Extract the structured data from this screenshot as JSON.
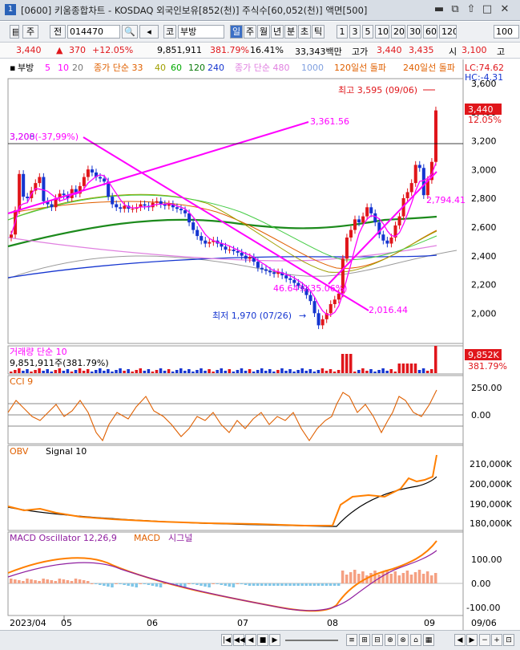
{
  "window": {
    "number": "1",
    "title": "[0600] 키움종합차트 - KOSDAQ 외국인보유[852(천)] 주식수[60,052(천)] 액면[500]"
  },
  "toolbar": {
    "stock_code": "014470",
    "stock_name": "부방",
    "type_label": "주",
    "opt_label": "전",
    "market": "코",
    "periods": [
      "일",
      "주",
      "월",
      "년",
      "분",
      "초",
      "틱"
    ],
    "selected_period": "일",
    "numbers": [
      "1",
      "3",
      "5",
      "10",
      "20",
      "30",
      "60",
      "120"
    ],
    "count": "100"
  },
  "quote": {
    "price": "3,440",
    "change": "370",
    "change_pct": "+12.05%",
    "volume": "9,851,911",
    "vol_ratio": "381.79%",
    "turnover": "16.41%",
    "amount": "33,343백만",
    "high_label": "고가",
    "high_val": "3,440",
    "low_val": "3,435",
    "open_label": "시",
    "open_val": "3,100",
    "close_label": "고"
  },
  "legend": {
    "name": "부방",
    "ma": [
      "5",
      "10",
      "20"
    ],
    "ma_colors": [
      "#ff00ff",
      "#ff00ff",
      "#ff00ff"
    ],
    "l2": "종가 단순 33",
    "l3": [
      "40",
      "60",
      "120",
      "240"
    ],
    "l4": "종가 단순 480",
    "l5": "1000",
    "l6": "120일선 돌파",
    "l7": "240일선 돌파",
    "lc": "LC:74.62",
    "hc": "HC:-4.31"
  },
  "price_panel": {
    "yticks": [
      "3,600",
      "3,400",
      "3,200",
      "3,000",
      "2,800",
      "2,600",
      "2,400",
      "2,200",
      "2,000"
    ],
    "ymin": 1900,
    "ymax": 3650,
    "current": "3,440",
    "current_pct": "12.05%",
    "high_note": "최고 3,595 (09/06)",
    "low_note": "최저 1,970 (07/26)",
    "fib_note1": "3,208",
    "fib_note2": "3,200(-37,99%)",
    "trend_label1": "3,361.56",
    "trend_label2": "2,016.44",
    "trend_label3": "2,794.41",
    "pct_label": "46.64%(35.06%)"
  },
  "volume_panel": {
    "title": "거래량 단순 10",
    "info": "9,851,911주(381.79%)",
    "current": "9,852K",
    "current_pct": "381.79%"
  },
  "cci_panel": {
    "title": "CCI 9",
    "yticks": [
      "250.00",
      "0.00"
    ]
  },
  "obv_panel": {
    "title": "OBV",
    "signal": "Signal 10",
    "yticks": [
      "210,000K",
      "200,000K",
      "190,000K",
      "180,000K"
    ]
  },
  "macd_panel": {
    "title": "MACD Oscillator 12,26,9",
    "l2": "MACD",
    "l3": "시그널",
    "yticks": [
      "100.00",
      "0.00",
      "-100.00"
    ]
  },
  "xaxis": {
    "labels": [
      "2023/04",
      "05",
      "06",
      "07",
      "08",
      "09",
      "09/06"
    ]
  },
  "colors": {
    "up": "#e0161b",
    "down": "#1535d0",
    "trend": "#ff00ff",
    "ma120": "#1c8a1c",
    "macd": "#ff7f00"
  },
  "chart_data": {
    "type": "candlestick",
    "close": [
      2620,
      2780,
      3020,
      2870,
      2860,
      2910,
      2960,
      3000,
      2840,
      2820,
      2800,
      2860,
      2890,
      2880,
      2860,
      2920,
      2890,
      2940,
      3000,
      3050,
      3030,
      3000,
      2990,
      2970,
      2870,
      2820,
      2800,
      2790,
      2810,
      2790,
      2790,
      2800,
      2820,
      2810,
      2800,
      2830,
      2840,
      2820,
      2810,
      2820,
      2800,
      2790,
      2780,
      2760,
      2700,
      2650,
      2610,
      2580,
      2560,
      2570,
      2580,
      2560,
      2540,
      2520,
      2520,
      2510,
      2500,
      2480,
      2460,
      2470,
      2440,
      2400,
      2390,
      2380,
      2370,
      2360,
      2370,
      2350,
      2330,
      2320,
      2300,
      2280,
      2260,
      2220,
      2180,
      2100,
      2020,
      2060,
      2100,
      2160,
      2190,
      2230,
      2460,
      2600,
      2650,
      2720,
      2700,
      2740,
      2800,
      2760,
      2700,
      2620,
      2580,
      2560,
      2600,
      2680,
      2740,
      2860,
      2900,
      2960,
      3080,
      3060,
      2880,
      2980,
      3100,
      3440
    ]
  }
}
